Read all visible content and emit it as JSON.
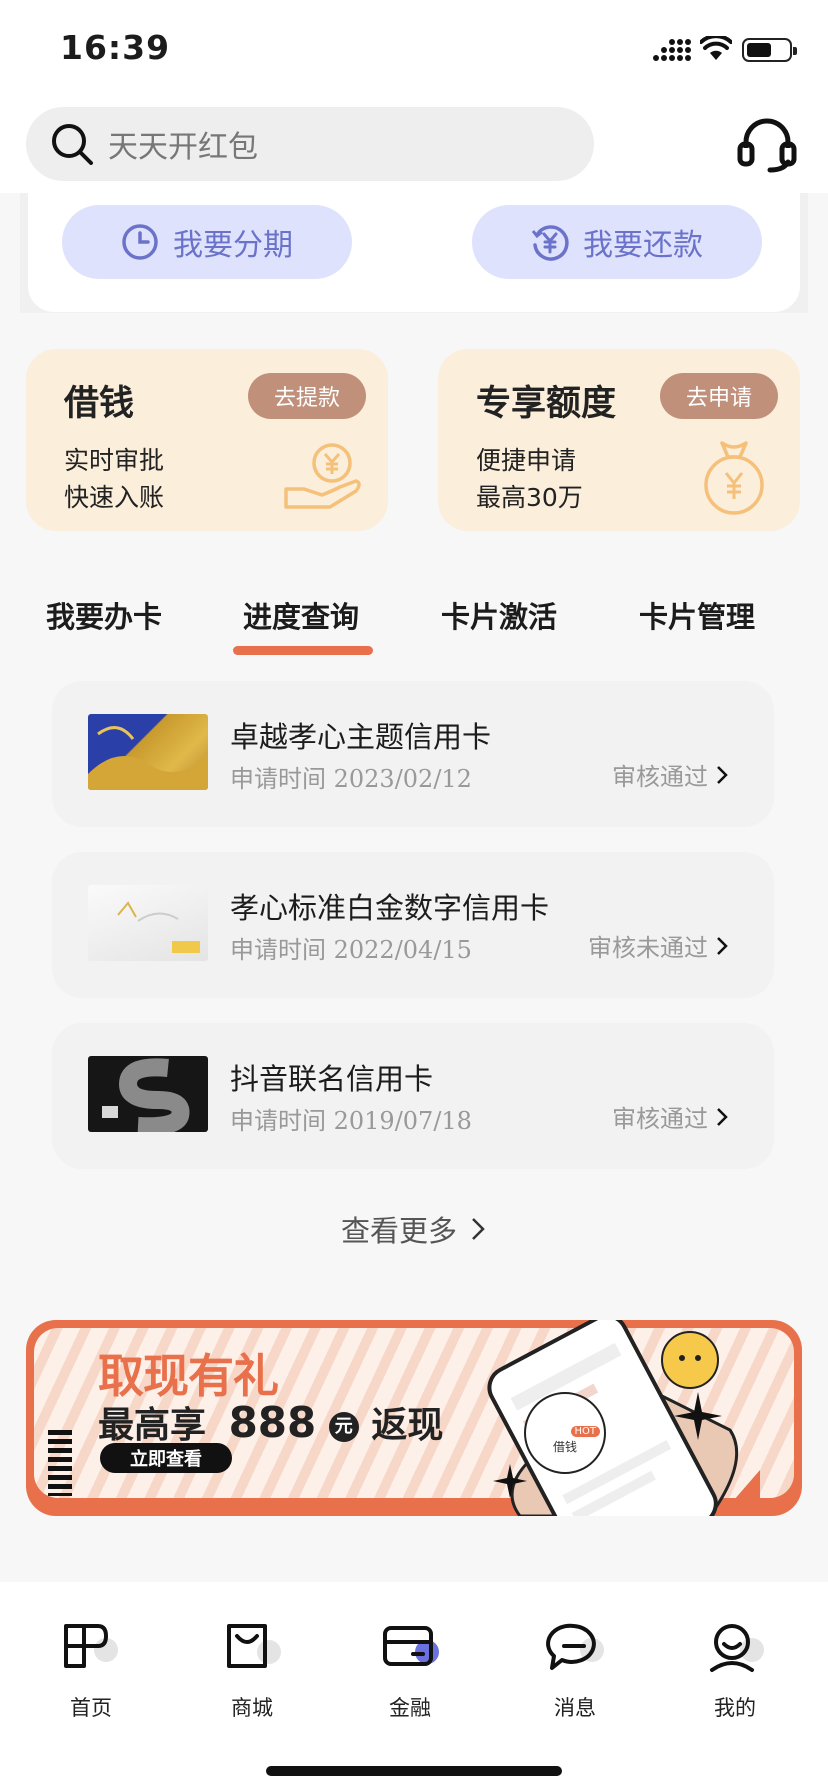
{
  "status_bar": {
    "time": "16:39"
  },
  "search": {
    "placeholder": "天天开红包"
  },
  "quick_actions": [
    {
      "label": "我要分期",
      "icon": "clock-icon"
    },
    {
      "label": "我要还款",
      "icon": "yuan-refresh-icon"
    }
  ],
  "promo_cards": [
    {
      "title": "借钱",
      "button": "去提款",
      "line1": "实时审批",
      "line2": "快速入账",
      "icon": "hand-coin-icon"
    },
    {
      "title": "专享额度",
      "button": "去申请",
      "line1": "便捷申请",
      "line2": "最高30万",
      "icon": "money-bag-icon"
    }
  ],
  "tabs": [
    {
      "label": "我要办卡",
      "active": false
    },
    {
      "label": "进度查询",
      "active": true
    },
    {
      "label": "卡片激活",
      "active": false
    },
    {
      "label": "卡片管理",
      "active": false
    }
  ],
  "applications": [
    {
      "name": "卓越孝心主题信用卡",
      "date": "申请时间 2023/02/12",
      "status": "审核通过"
    },
    {
      "name": "孝心标准白金数字信用卡",
      "date": "申请时间 2022/04/15",
      "status": "审核未通过"
    },
    {
      "name": "抖音联名信用卡",
      "date": "申请时间 2019/07/18",
      "status": "审核通过"
    }
  ],
  "view_more": "查看更多",
  "banner": {
    "title": "取现有礼",
    "subtitle_prefix": "最高享",
    "amount": "888",
    "unit": "元",
    "subtitle_suffix": "返现",
    "cta": "立即查看",
    "chip_label": "借钱",
    "chip_badge": "HOT"
  },
  "bottom_nav": [
    {
      "label": "首页",
      "icon": "home-icon"
    },
    {
      "label": "商城",
      "icon": "shop-bag-icon"
    },
    {
      "label": "金融",
      "icon": "card-icon",
      "active": true
    },
    {
      "label": "消息",
      "icon": "message-icon"
    },
    {
      "label": "我的",
      "icon": "profile-icon"
    }
  ],
  "colors": {
    "accent": "#e8714c",
    "pill_bg": "#dfe2fd",
    "pill_text": "#6a73c9",
    "promo_bg": "#fbeedb",
    "promo_btn": "#c0907b"
  }
}
